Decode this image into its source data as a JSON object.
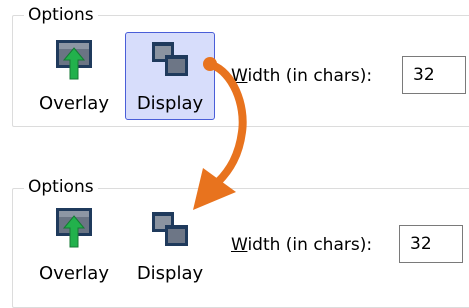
{
  "colors": {
    "selection_fill": "#d7ddfb",
    "selection_border": "#4a5ed8",
    "annotation_arrow": "#e8731e",
    "overlay_arrow": "#22b14c"
  },
  "panels": [
    {
      "legend": "Options",
      "overlay": {
        "label": "Overlay",
        "icon": "overlay-icon",
        "selected": false
      },
      "display": {
        "label": "Display",
        "icon": "display-windows-icon",
        "selected": true
      },
      "width_label": {
        "mnemonic": "W",
        "rest": "idth (in chars):"
      },
      "width_value": "32"
    },
    {
      "legend": "Options",
      "overlay": {
        "label": "Overlay",
        "icon": "overlay-icon",
        "selected": false
      },
      "display": {
        "label": "Display",
        "icon": "display-windows-icon",
        "selected": false
      },
      "width_label": {
        "mnemonic": "W",
        "rest": "idth (in chars):"
      },
      "width_value": "32"
    }
  ]
}
